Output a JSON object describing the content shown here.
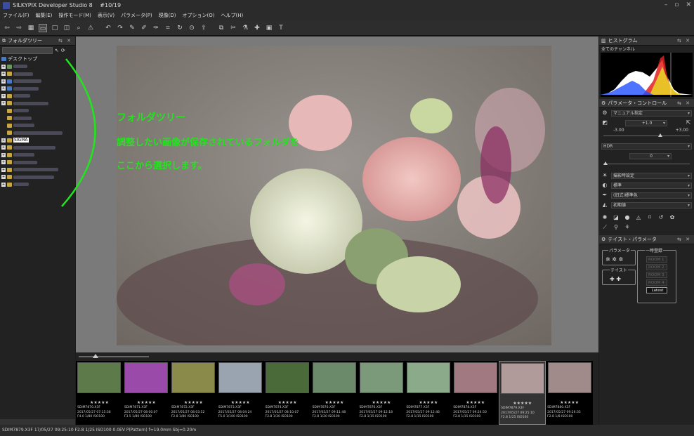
{
  "window": {
    "title": "SILKYPIX Developer Studio 8 　#10/19",
    "controls": [
      "–",
      "▫",
      "✕"
    ]
  },
  "menu": [
    "ファイル(F)",
    "編集(E)",
    "操作モード(M)",
    "表示(V)",
    "パラメータ(P)",
    "現像(D)",
    "オプション(O)",
    "ヘルプ(H)"
  ],
  "folder_panel": {
    "title": "フォルダツリー",
    "root": "デスクトップ",
    "selected_folder": "SIGMA"
  },
  "annotation": {
    "title": "フォルダツリー",
    "line1": "調整したい画像が保存されているフォルダを",
    "line2": "ここから選択します。",
    "color": "#22e41c"
  },
  "histogram": {
    "title": "ヒストグラム",
    "channel": "全てのチャンネル"
  },
  "param_control": {
    "title": "パラメータ・コントロール",
    "preset": "マニュアル指定",
    "exposure_value": "+1.0",
    "exposure_min": "-3.00",
    "exposure_max": "+3.00",
    "hdr_label": "HDR",
    "hdr_value": "0",
    "white_balance": "撮影時設定",
    "tone": "標準",
    "color": "(旧式)標準色",
    "sharpness": "初期値"
  },
  "taste": {
    "title": "テイスト・パラメータ",
    "param_label": "パラメータ",
    "taste_label": "テイスト",
    "memory_label": "一時登録",
    "slots": [
      "ROOM 1",
      "ROOM 2",
      "ROOM 3",
      "ROOM 4"
    ],
    "latest": "Latest"
  },
  "thumbnails": [
    {
      "name": "SDIM7870.X3F",
      "date": "2017/05/27 07:15:36",
      "info": "F4.0 1/80 ISO100",
      "color": "#5c7a4a"
    },
    {
      "name": "SDIM7871.X3F",
      "date": "2017/05/27 08:00:07",
      "info": "F3.5 1/80 ISO100",
      "color": "#9a4aa8"
    },
    {
      "name": "SDIM7872.X3F",
      "date": "2017/05/27 08:03:52",
      "info": "F2.8 1/80 ISO100",
      "color": "#8a8a4a"
    },
    {
      "name": "SDIM7873.X3F",
      "date": "2017/05/27 08:04:24",
      "info": "F5.0 1/100 ISO100",
      "color": "#9aa4b0"
    },
    {
      "name": "SDIM7874.X3F",
      "date": "2017/05/27 08:10:07",
      "info": "F2.8 1/30 ISO100",
      "color": "#4a6a3a"
    },
    {
      "name": "SDIM7876.X3F",
      "date": "2017/05/27 09:11:48",
      "info": "F2.8 1/20 ISO100",
      "color": "#6a8a6a"
    },
    {
      "name": "SDIM7876.X3F",
      "date": "2017/05/27 09:12:18",
      "info": "F2.8 1/15 ISO100",
      "color": "#7a9a7a"
    },
    {
      "name": "SDIM7877.X3F",
      "date": "2017/05/27 09:12:46",
      "info": "F2.8 1/15 ISO100",
      "color": "#8aaa8a"
    },
    {
      "name": "SDIM7878.X3F",
      "date": "2017/05/27 09:24:50",
      "info": "F2.8 1/15 ISO100",
      "color": "#a07a80"
    },
    {
      "name": "SDIM7879.X3F",
      "date": "2017/05/27 09:25:10",
      "info": "F2.8 1/25 ISO100",
      "color": "#b09a9a"
    },
    {
      "name": "SDIM7880.X3F",
      "date": "2017/05/27 09:26:35",
      "info": "F2.8 1/8 ISO100",
      "color": "#a08a8a"
    }
  ],
  "stars": "★★★★★",
  "status": "SDIM7879.X3F 17/05/27 09:25:10 F2.8 1/25 ISO100  0.0EV P(Pattern) f=19.0mm Sbj=0.20m"
}
